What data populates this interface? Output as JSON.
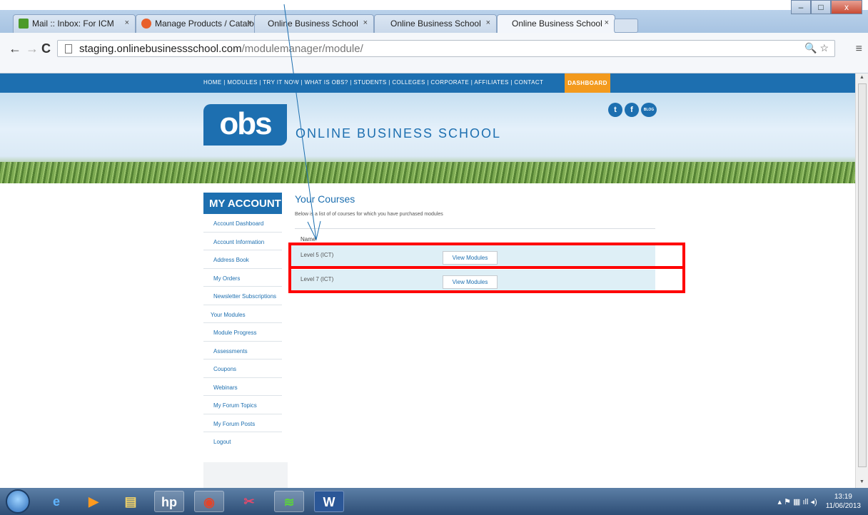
{
  "browser": {
    "tabs": [
      {
        "label": "Mail :: Inbox: For ICM",
        "icon": "mail-icon",
        "color": "#4c9a2a"
      },
      {
        "label": "Manage Products / Catalo",
        "icon": "magento-icon",
        "color": "#e8602c"
      },
      {
        "label": "Online Business School",
        "icon": "",
        "color": ""
      },
      {
        "label": "Online Business School",
        "icon": "",
        "color": ""
      },
      {
        "label": "Online Business School",
        "icon": "",
        "color": ""
      }
    ],
    "tab_close": "×",
    "active_tab": 4,
    "url_host": "staging.onlinebusinessschool.com",
    "url_path": "/modulemanager/module/",
    "window_controls": [
      "–",
      "□",
      "x"
    ]
  },
  "site": {
    "nav_text": "HOME | MODULES | TRY IT NOW | WHAT IS OBS? | STUDENTS | COLLEGES | CORPORATE | AFFILIATES | CONTACT",
    "dashboard_label": "DASHBOARD",
    "logo_text": "obs",
    "brand_name": "ONLINE BUSINESS SCHOOL",
    "social": {
      "twitter": "t",
      "facebook": "f",
      "blog": "BLOG"
    }
  },
  "sidebar": {
    "title": "MY ACCOUNT",
    "items": [
      "Account Dashboard",
      "Account Information",
      "Address Book",
      "My Orders",
      "Newsletter Subscriptions",
      "Your Modules",
      "Module Progress",
      "Assessments",
      "Coupons",
      "Webinars",
      "My Forum Topics",
      "My Forum Posts",
      "Logout"
    ]
  },
  "courses": {
    "title": "Your Courses",
    "subtitle": "Below is a list of of courses for which you have purchased modules",
    "column_name": "Name",
    "rows": [
      {
        "name": "Level 5 (ICT)",
        "button": "View Modules"
      },
      {
        "name": "Level 7 (ICT)",
        "button": "View Modules"
      }
    ]
  },
  "taskbar": {
    "apps": [
      "start-orb",
      "ie-icon",
      "media-player-icon",
      "file-explorer-icon",
      "hp-icon",
      "chrome-icon",
      "snipping-tool-icon",
      "spotify-icon",
      "word-icon"
    ],
    "time": "13:19",
    "date": "11/06/2013"
  },
  "colors": {
    "brand_blue": "#1d6fb0",
    "dashboard_orange": "#f39a1d",
    "highlight_red": "#ff0000",
    "row_bg": "#deeff6"
  }
}
